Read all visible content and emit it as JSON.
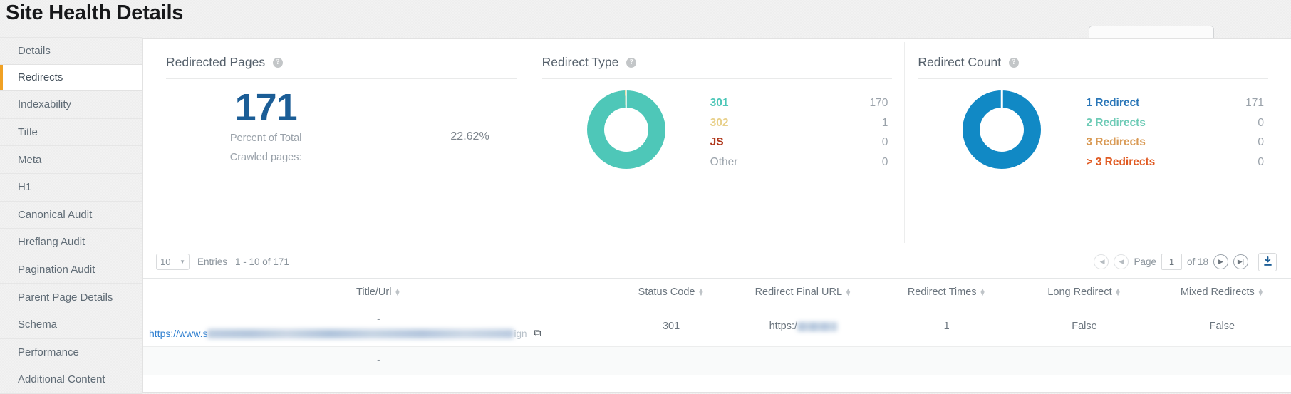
{
  "page": {
    "title": "Site Health Details"
  },
  "sidebar": {
    "items": [
      {
        "label": "Details",
        "active": false
      },
      {
        "label": "Redirects",
        "active": true
      },
      {
        "label": "Indexability",
        "active": false
      },
      {
        "label": "Title",
        "active": false
      },
      {
        "label": "Meta",
        "active": false
      },
      {
        "label": "H1",
        "active": false
      },
      {
        "label": "Canonical Audit",
        "active": false
      },
      {
        "label": "Hreflang Audit",
        "active": false
      },
      {
        "label": "Pagination Audit",
        "active": false
      },
      {
        "label": "Parent Page Details",
        "active": false
      },
      {
        "label": "Schema",
        "active": false
      },
      {
        "label": "Performance",
        "active": false
      },
      {
        "label": "Additional Content",
        "active": false
      }
    ]
  },
  "cards": {
    "redirected_pages": {
      "title": "Redirected Pages",
      "help_icon": "help-circle-icon",
      "value": "171",
      "label_line1": "Percent of Total",
      "label_line2": "Crawled pages:",
      "percent": "22.62%",
      "value_color": "#1b5d96"
    },
    "redirect_type": {
      "title": "Redirect Type",
      "help_icon": "help-circle-icon",
      "legend": [
        {
          "label": "301",
          "value": "170",
          "color": "#4ec7b8",
          "bold": true
        },
        {
          "label": "302",
          "value": "1",
          "color": "#e8d08a",
          "bold": true
        },
        {
          "label": "JS",
          "value": "0",
          "color": "#b0381c",
          "bold": true
        },
        {
          "label": "Other",
          "value": "0",
          "color": "#9aa2aa",
          "bold": false
        }
      ]
    },
    "redirect_count": {
      "title": "Redirect Count",
      "help_icon": "help-circle-icon",
      "legend": [
        {
          "label": "1 Redirect",
          "value": "171",
          "color": "#2a76b8",
          "bold": true
        },
        {
          "label": "2 Redirects",
          "value": "0",
          "color": "#6ecbb6",
          "bold": true
        },
        {
          "label": "3 Redirects",
          "value": "0",
          "color": "#d99a55",
          "bold": true
        },
        {
          "label": "> 3 Redirects",
          "value": "0",
          "color": "#e05a22",
          "bold": true
        }
      ]
    }
  },
  "chart_data": [
    {
      "type": "pie",
      "title": "Redirect Type",
      "labels": [
        "301",
        "302",
        "JS",
        "Other"
      ],
      "values": [
        170,
        1,
        0,
        0
      ],
      "colors": [
        "#4ec7b8",
        "#e8d08a",
        "#b0381c",
        "#9aa2aa"
      ],
      "donut": true,
      "legend": "right"
    },
    {
      "type": "pie",
      "title": "Redirect Count",
      "labels": [
        "1 Redirect",
        "2 Redirects",
        "3 Redirects",
        "> 3 Redirects"
      ],
      "values": [
        171,
        0,
        0,
        0
      ],
      "colors": [
        "#1189c5",
        "#6ecbb6",
        "#d99a55",
        "#e05a22"
      ],
      "donut": true,
      "legend": "right"
    }
  ],
  "toolbar": {
    "entries_value": "10",
    "entries_label": "Entries",
    "range_label": "1 - 10 of 171",
    "first_icon": "first-page-icon",
    "prev_icon": "previous-page-icon",
    "page_label": "Page",
    "page_value": "1",
    "of_label": "of 18",
    "next_icon": "next-page-icon",
    "last_icon": "last-page-icon",
    "download_icon": "download-icon"
  },
  "table": {
    "columns": [
      "Title/Url",
      "Status Code",
      "Redirect Final URL",
      "Redirect Times",
      "Long Redirect",
      "Mixed Redirects"
    ],
    "rows": [
      {
        "dash": "-",
        "url_prefix": "https://www.s",
        "url_suffix": "ign",
        "status_code": "301",
        "final_url_prefix": "https:/",
        "redirect_times": "1",
        "long_redirect": "False",
        "mixed_redirects": "False"
      },
      {
        "dash": "-",
        "url_prefix": "",
        "url_suffix": "",
        "status_code": "",
        "final_url_prefix": "",
        "redirect_times": "",
        "long_redirect": "",
        "mixed_redirects": ""
      }
    ]
  },
  "colors": {
    "accent_orange": "#f0a124",
    "kpi_blue": "#1b5d96",
    "donut_teal": "#54c9bc",
    "donut_blue": "#1189c5",
    "link_blue": "#2f7fd0"
  }
}
